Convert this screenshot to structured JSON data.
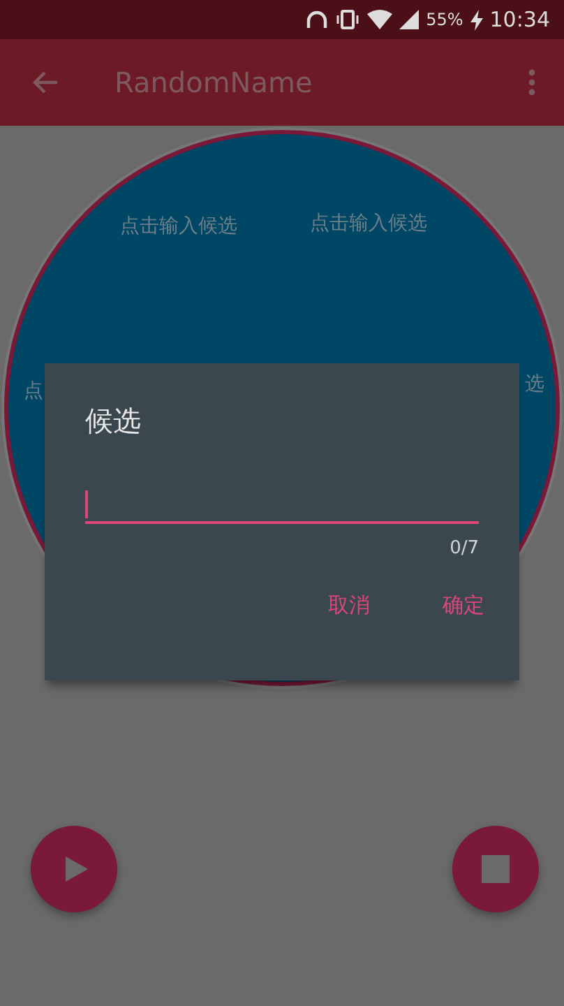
{
  "status_bar": {
    "battery": "55%",
    "time": "10:34"
  },
  "app_bar": {
    "title": "RandomName"
  },
  "wheel": {
    "labels": [
      "点击输入候选",
      "点击输入候选",
      "点",
      "选"
    ]
  },
  "dialog": {
    "title": "候选",
    "counter": "0/7",
    "buttons": [
      "取消",
      "确定"
    ]
  },
  "controls": [
    {
      "kind": "play"
    },
    {
      "kind": "stop"
    }
  ]
}
